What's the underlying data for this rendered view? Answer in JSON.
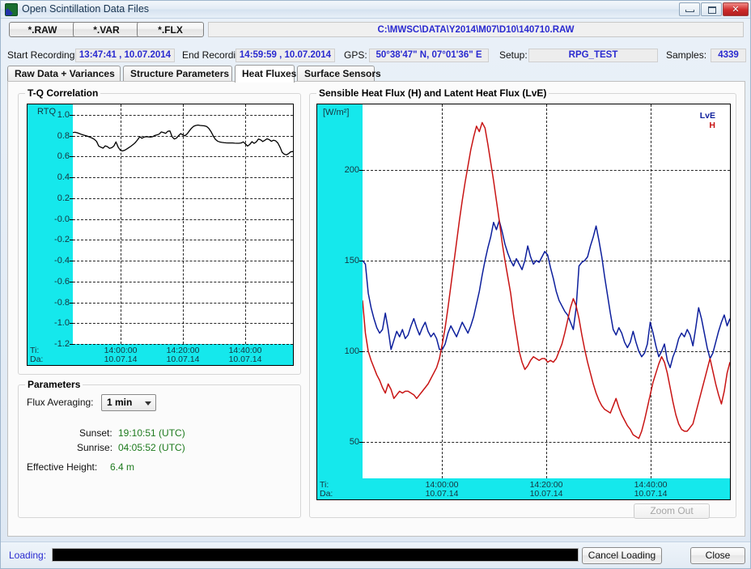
{
  "window": {
    "title": "Open Scintillation Data Files",
    "icon": "app-icon",
    "minimize_label": "",
    "maximize_label": "",
    "close_label": ""
  },
  "toolbar": {
    "raw_label": "*.RAW",
    "var_label": "*.VAR",
    "flx_label": "*.FLX",
    "filepath": "C:\\MWSC\\DATA\\Y2014\\M07\\D10\\140710.RAW"
  },
  "info": {
    "start_label": "Start Recording:",
    "start_value": "13:47:41 , 10.07.2014",
    "end_label": "End Recording:",
    "end_value": "14:59:59 , 10.07.2014",
    "gps_label": "GPS:",
    "gps_value": "50°38'47\" N, 07°01'36\" E",
    "setup_label": "Setup:",
    "setup_value": "RPG_TEST",
    "samples_label": "Samples:",
    "samples_value": "4339"
  },
  "tabs": [
    {
      "label": "Raw Data + Variances",
      "active": false
    },
    {
      "label": "Structure Parameters",
      "active": false
    },
    {
      "label": "Heat Fluxes",
      "active": true
    },
    {
      "label": "Surface Sensors",
      "active": false
    }
  ],
  "groups": {
    "tq_title": "T-Q Correlation",
    "parameters_title": "Parameters",
    "flux_title": "Sensible Heat Flux (H) and Latent Heat Flux (LvE)"
  },
  "parameters": {
    "flux_averaging_label": "Flux Averaging:",
    "flux_averaging_value": "1 min",
    "flux_averaging_options": [
      "1 min"
    ],
    "sunset_label": "Sunset:",
    "sunset_value": "19:10:51 (UTC)",
    "sunrise_label": "Sunrise:",
    "sunrise_value": "04:05:52 (UTC)",
    "effective_height_label": "Effective Height:",
    "effective_height_value": "6.4 m"
  },
  "zoom_out_label": "Zoom Out",
  "status": {
    "loading_label": "Loading:",
    "progress_percent": 100,
    "cancel_label": "Cancel Loading",
    "close_label": "Close"
  },
  "chart_data": [
    {
      "id": "tq",
      "type": "line",
      "title": "T-Q Correlation",
      "ylabel": "RTQ",
      "xlabel": "",
      "axis_tags": {
        "time": "Ti:",
        "date": "Da:"
      },
      "ylim": [
        -1.2,
        1.1
      ],
      "yticks": [
        1.0,
        0.8,
        0.6,
        0.4,
        0.2,
        -0.0,
        -0.2,
        -0.4,
        -0.6,
        -0.8,
        -1.0,
        -1.2
      ],
      "ytick_labels": [
        "1.0",
        "0.8",
        "0.6",
        "0.4",
        "0.2",
        "-0.0",
        "-0.2",
        "-0.4",
        "-0.6",
        "-0.8",
        "-1.0",
        "-1.2"
      ],
      "grid": true,
      "xticks_time": [
        "14:00:00",
        "14:20:00",
        "14:40:00"
      ],
      "xticks_date": [
        "10.07.14",
        "10.07.14",
        "10.07.14"
      ],
      "xtick_positions": [
        0.2162,
        0.5,
        0.7838
      ],
      "series": [
        {
          "name": "RTQ",
          "color": "#000000",
          "values": [
            0.83,
            0.833,
            0.828,
            0.82,
            0.812,
            0.806,
            0.8,
            0.793,
            0.785,
            0.776,
            0.764,
            0.745,
            0.7,
            0.689,
            0.68,
            0.702,
            0.695,
            0.678,
            0.684,
            0.7,
            0.74,
            0.69,
            0.66,
            0.653,
            0.66,
            0.672,
            0.686,
            0.7,
            0.716,
            0.735,
            0.76,
            0.79,
            0.775,
            0.786,
            0.79,
            0.788,
            0.786,
            0.79,
            0.802,
            0.808,
            0.815,
            0.836,
            0.83,
            0.822,
            0.842,
            0.845,
            0.79,
            0.768,
            0.776,
            0.8,
            0.82,
            0.806,
            0.8,
            0.818,
            0.846,
            0.872,
            0.89,
            0.898,
            0.902,
            0.898,
            0.896,
            0.894,
            0.888,
            0.87,
            0.84,
            0.8,
            0.766,
            0.748,
            0.74,
            0.736,
            0.733,
            0.731,
            0.73,
            0.73,
            0.73,
            0.728,
            0.727,
            0.727,
            0.73,
            0.74,
            0.72,
            0.7,
            0.716,
            0.742,
            0.726,
            0.74,
            0.768,
            0.76,
            0.744,
            0.756,
            0.77,
            0.762,
            0.746,
            0.756,
            0.75,
            0.73,
            0.69,
            0.64,
            0.622,
            0.616,
            0.628,
            0.645,
            0.648
          ]
        }
      ]
    },
    {
      "id": "flux",
      "type": "line",
      "title": "Sensible Heat Flux (H) and Latent Heat Flux (LvE)",
      "ylabel": "[W/m²]",
      "xlabel": "",
      "axis_tags": {
        "time": "Ti:",
        "date": "Da:"
      },
      "ylim": [
        30,
        236
      ],
      "yticks": [
        200,
        150,
        100,
        50
      ],
      "ytick_labels": [
        "200",
        "150",
        "100",
        "50"
      ],
      "grid": true,
      "legend": [
        {
          "label": "LvE",
          "color": "#0d1f9c"
        },
        {
          "label": "H",
          "color": "#c81414"
        }
      ],
      "legend_position": "top-right",
      "xticks_time": [
        "14:00:00",
        "14:20:00",
        "14:40:00"
      ],
      "xticks_date": [
        "10.07.14",
        "10.07.14",
        "10.07.14"
      ],
      "xtick_positions": [
        0.2162,
        0.5,
        0.7838
      ],
      "series": [
        {
          "name": "LvE",
          "color": "#0d1f9c",
          "values": [
            150,
            148,
            132,
            124,
            118,
            113,
            110,
            112,
            121,
            112,
            101,
            106,
            111,
            108,
            112,
            107,
            109,
            114,
            118,
            113,
            109,
            113,
            116,
            111,
            108,
            110,
            107,
            101,
            101,
            104,
            110,
            114,
            111,
            108,
            112,
            116,
            113,
            110,
            114,
            119,
            126,
            133,
            142,
            150,
            157,
            163,
            171,
            167,
            172,
            166,
            159,
            154,
            150,
            147,
            151,
            148,
            145,
            150,
            158,
            152,
            148,
            150,
            149,
            152,
            155,
            153,
            146,
            140,
            133,
            128,
            125,
            122,
            120,
            116,
            112,
            124,
            147,
            149,
            150,
            152,
            158,
            163,
            169,
            161,
            152,
            141,
            131,
            121,
            112,
            109,
            113,
            110,
            105,
            102,
            105,
            111,
            105,
            100,
            97,
            99,
            104,
            116,
            110,
            103,
            97,
            100,
            104,
            95,
            91,
            97,
            101,
            107,
            110,
            108,
            112,
            109,
            103,
            113,
            124,
            118,
            110,
            102,
            96,
            99,
            105,
            111,
            116,
            120,
            114,
            118
          ]
        },
        {
          "name": "H",
          "color": "#c81414",
          "values": [
            128,
            110,
            100,
            95,
            91,
            87,
            84,
            80,
            77,
            82,
            79,
            74,
            76,
            78,
            77,
            78,
            78,
            77,
            76,
            74,
            76,
            78,
            80,
            82,
            85,
            88,
            91,
            96,
            104,
            113,
            124,
            136,
            148,
            160,
            172,
            183,
            193,
            202,
            211,
            218,
            224,
            221,
            226,
            223,
            214,
            204,
            194,
            183,
            172,
            160,
            150,
            141,
            132,
            120,
            110,
            100,
            94,
            90,
            92,
            95,
            97,
            96,
            95,
            96,
            96,
            94,
            95,
            94,
            96,
            100,
            104,
            110,
            117,
            124,
            129,
            125,
            118,
            109,
            101,
            94,
            88,
            82,
            77,
            73,
            70,
            68,
            67,
            66,
            70,
            74,
            69,
            65,
            62,
            59,
            57,
            54,
            53,
            52,
            56,
            62,
            69,
            76,
            83,
            88,
            93,
            97,
            94,
            88,
            80,
            72,
            65,
            60,
            57,
            56,
            56,
            58,
            60,
            66,
            72,
            78,
            84,
            90,
            96,
            89,
            82,
            76,
            71,
            78,
            88,
            94
          ]
        }
      ]
    }
  ]
}
